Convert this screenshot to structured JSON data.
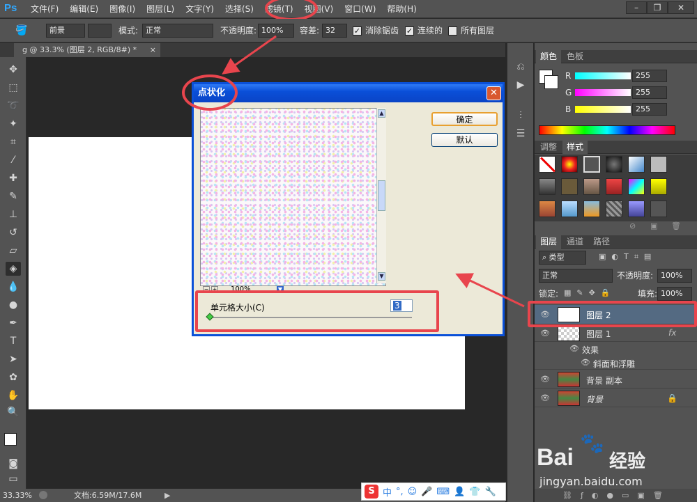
{
  "menubar": {
    "logo": "Ps",
    "items": [
      "文件(F)",
      "编辑(E)",
      "图像(I)",
      "图层(L)",
      "文字(Y)",
      "选择(S)",
      "滤镜(T)",
      "视图(V)",
      "窗口(W)",
      "帮助(H)"
    ],
    "window_buttons": [
      "–",
      "❐",
      "✕"
    ]
  },
  "options": {
    "fill_source": "前景",
    "mode_label": "模式:",
    "mode_value": "正常",
    "opacity_label": "不透明度:",
    "opacity_value": "100%",
    "tolerance_label": "容差:",
    "tolerance_value": "32",
    "antialias_label": "消除锯齿",
    "contiguous_label": "连续的",
    "all_layers_label": "所有图层"
  },
  "document_tab": {
    "title": "g @ 33.3% (图层 2, RGB/8#) *",
    "close": "×"
  },
  "status": {
    "zoom": "33.33%",
    "doc_info": "文档:6.59M/17.6M"
  },
  "color_panel": {
    "tabs": [
      "颜色",
      "色板"
    ],
    "channels": [
      {
        "label": "R",
        "value": "255"
      },
      {
        "label": "G",
        "value": "255"
      },
      {
        "label": "B",
        "value": "255"
      }
    ]
  },
  "styles_panel": {
    "tabs": [
      "调整",
      "样式"
    ]
  },
  "layers_panel": {
    "tabs": [
      "图层",
      "通道",
      "路径"
    ],
    "filter_kind": "类型",
    "blend_mode": "正常",
    "opacity_label": "不透明度:",
    "opacity_value": "100%",
    "lock_label": "锁定:",
    "fill_label": "填充:",
    "fill_value": "100%",
    "layers": [
      {
        "name": "图层 2"
      },
      {
        "name": "图层 1",
        "fx": "fx"
      },
      {
        "name": "效果"
      },
      {
        "name": "斜面和浮雕"
      },
      {
        "name": "背景 副本"
      },
      {
        "name": "背景"
      }
    ]
  },
  "dialog": {
    "title": "点状化",
    "close": "✕",
    "ok": "确定",
    "default": "默认",
    "zoom": "100%",
    "cell_label": "单元格大小(C)",
    "cell_value": "3"
  },
  "ime": {
    "logo": "S",
    "lang": "中",
    "items": [
      "°,",
      "☺",
      "🎤",
      "⌨",
      "👤",
      "👕",
      "🔧"
    ]
  },
  "watermark": {
    "brand": "Bai",
    "brand_cn": "经验",
    "url": "jingyan.baidu.com"
  },
  "colors": {
    "accent_red": "#e8454d",
    "xp_blue": "#0a50d8",
    "selected_layer": "#546a82"
  }
}
